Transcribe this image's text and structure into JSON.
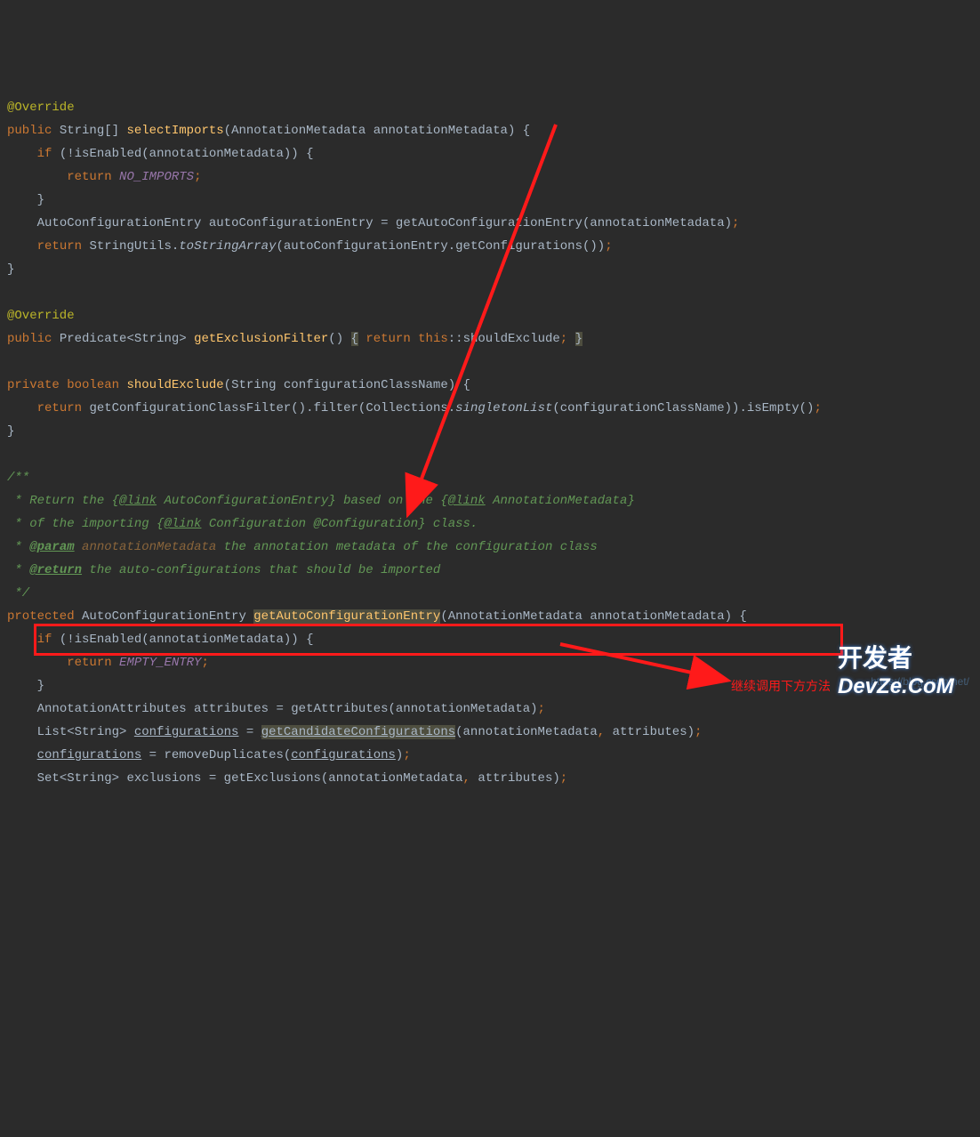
{
  "code": {
    "override1": "@Override",
    "public": "public",
    "string_arr": "String[]",
    "selectImports": "selectImports",
    "annotationMetadata_type": "AnnotationMetadata",
    "annotationMetadata_param": "annotationMetadata",
    "if": "if",
    "isEnabled": "isEnabled",
    "return": "return",
    "NO_IMPORTS": "NO_IMPORTS",
    "AutoConfigurationEntry": "AutoConfigurationEntry",
    "autoConfigurationEntry_var": "autoConfigurationEntry",
    "getAutoConfigurationEntry": "getAutoConfigurationEntry",
    "StringUtils": "StringUtils",
    "toStringArray": "toStringArray",
    "getConfigurations": "getConfigurations",
    "override2": "@Override",
    "Predicate": "Predicate<String>",
    "getExclusionFilter": "getExclusionFilter",
    "this": "this",
    "shouldExclude": "shouldExclude",
    "private": "private",
    "boolean": "boolean",
    "shouldExclude_decl": "shouldExclude",
    "String": "String",
    "configurationClassName": "configurationClassName",
    "getConfigurationClassFilter": "getConfigurationClassFilter",
    "filter": "filter",
    "Collections": "Collections",
    "singletonList": "singletonList",
    "isEmpty": "isEmpty",
    "doc_open": "/**",
    "doc_l1_a": " * Return the {",
    "doc_l1_link": "@link",
    "doc_l1_b": " AutoConfigurationEntry} based on the {",
    "doc_l1_link2": "@link",
    "doc_l1_c": " AnnotationMetadata}",
    "doc_l2_a": " * of the importing {",
    "doc_l2_link": "@link",
    "doc_l2_b": " Configuration @Configuration} class.",
    "doc_l3_a": " * ",
    "doc_l3_param": "@param",
    "doc_l3_name": " annotationMetadata",
    "doc_l3_b": " the annotation metadata of the configuration class",
    "doc_l4_a": " * ",
    "doc_l4_return": "@return",
    "doc_l4_b": " the auto-configurations that should be imported",
    "doc_close": " */",
    "protected": "protected",
    "EMPTY_ENTRY": "EMPTY_ENTRY",
    "AnnotationAttributes": "AnnotationAttributes",
    "attributes": "attributes",
    "getAttributes": "getAttributes",
    "ListString": "List<String>",
    "configurations": "configurations",
    "getCandidateConfigurations": "getCandidateConfigurations",
    "removeDuplicates": "removeDuplicates",
    "SetString": "Set<String>",
    "exclusions": "exclusions",
    "getExclusions": "getExclusions"
  },
  "annotations": {
    "red_text": "继续调用下方方法",
    "watermark": "https://blog.csdn.net/",
    "logo_zh": "开发者",
    "logo_en": "DevZe.CoM"
  }
}
